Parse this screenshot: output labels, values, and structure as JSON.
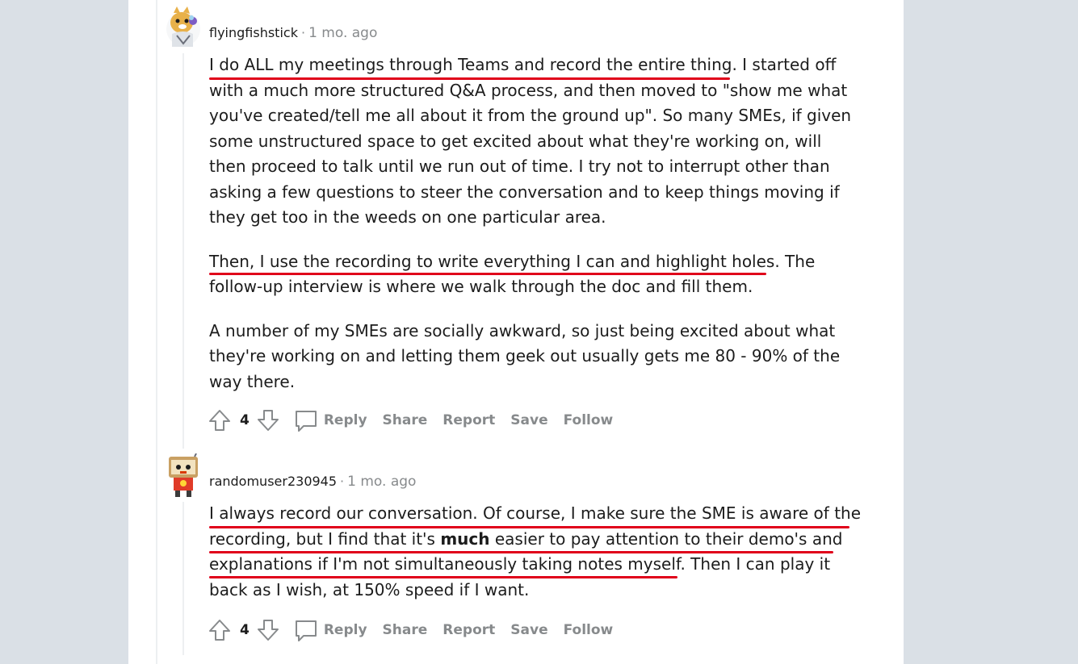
{
  "colors": {
    "background": "#dae0e6",
    "panel": "#ffffff",
    "underline": "#e0001a",
    "muted": "#878a8c"
  },
  "comments": [
    {
      "username": "flyingfishstick",
      "separator": "·",
      "time": "1 mo. ago",
      "paragraphs": [
        "I do ALL my meetings through Teams and record the entire thing. I started off with a much more structured Q&A process, and then moved to \"show me what you've created/tell me all about it from the ground up\". So many SMEs, if given some unstructured space to get excited about what they're working on, will then proceed to talk until we run out of time. I try not to interrupt other than asking a few questions to steer the conversation and to keep things moving if they get too in the weeds on one particular area.",
        "Then, I use the recording to write everything I can and highlight holes. The follow-up interview is where we walk through the doc and fill them.",
        "A number of my SMEs are socially awkward, so just being excited about what they're working on and letting them geek out usually gets me 80 - 90% of the way there."
      ],
      "score": "4",
      "actions": {
        "reply": "Reply",
        "share": "Share",
        "report": "Report",
        "save": "Save",
        "follow": "Follow"
      }
    },
    {
      "username": "randomuser230945",
      "separator": "·",
      "time": "1 mo. ago",
      "text_before_bold": "I always record our conversation. Of course, I make sure the SME is aware of the recording, but I find that it's ",
      "bold": "much",
      "text_after_bold": " easier to pay attention to their demo's and explanations if I'm not simultaneously taking notes myself. Then I can play it back as I wish, at 150% speed if I want.",
      "score": "4",
      "actions": {
        "reply": "Reply",
        "share": "Share",
        "report": "Report",
        "save": "Save",
        "follow": "Follow"
      }
    }
  ]
}
